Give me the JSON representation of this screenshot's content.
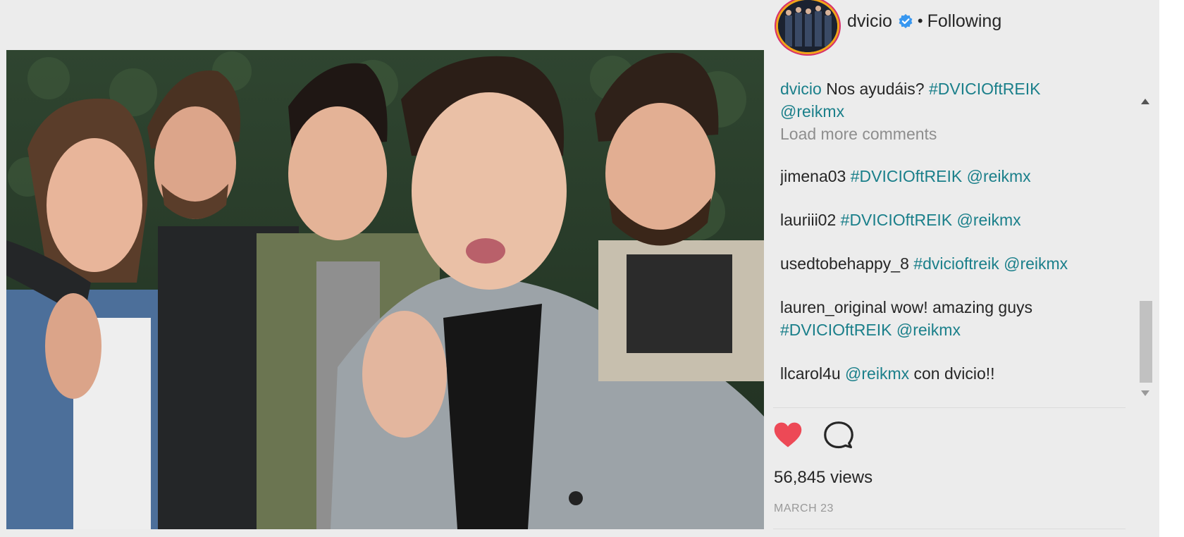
{
  "header": {
    "username": "dvicio",
    "separator": "•",
    "follow_status": "Following"
  },
  "caption": {
    "username": "dvicio",
    "text": "Nos ayudáis?",
    "hashtag": "#DVICIOftREIK",
    "mention": "@reikmx"
  },
  "load_more_label": "Load more comments",
  "comments": [
    {
      "username": "jimena03",
      "text": "",
      "hashtag": "#DVICIOftREIK",
      "mention": "@reikmx",
      "suffix": ""
    },
    {
      "username": "lauriii02",
      "text": "",
      "hashtag": "#DVICIOftREIK",
      "mention": "@reikmx",
      "suffix": ""
    },
    {
      "username": "usedtobehappy_8",
      "text": "",
      "hashtag": "#dvicioftreik",
      "mention": "@reikmx",
      "suffix": ""
    },
    {
      "username": "lauren_original",
      "text": "wow! amazing guys",
      "hashtag": "#DVICIOftREIK",
      "mention": "@reikmx",
      "suffix": ""
    },
    {
      "username": "llcarol4u",
      "text": "",
      "hashtag": "",
      "mention": "@reikmx",
      "suffix": "con dvicio!!"
    }
  ],
  "stats": {
    "views": "56,845 views",
    "date": "MARCH 23"
  },
  "colors": {
    "heart": "#ed4956",
    "link": "#1a7f8a",
    "verified": "#3897f0"
  },
  "icons": {
    "like": "heart-icon",
    "comment": "comment-icon",
    "verified": "verified-badge-icon"
  }
}
